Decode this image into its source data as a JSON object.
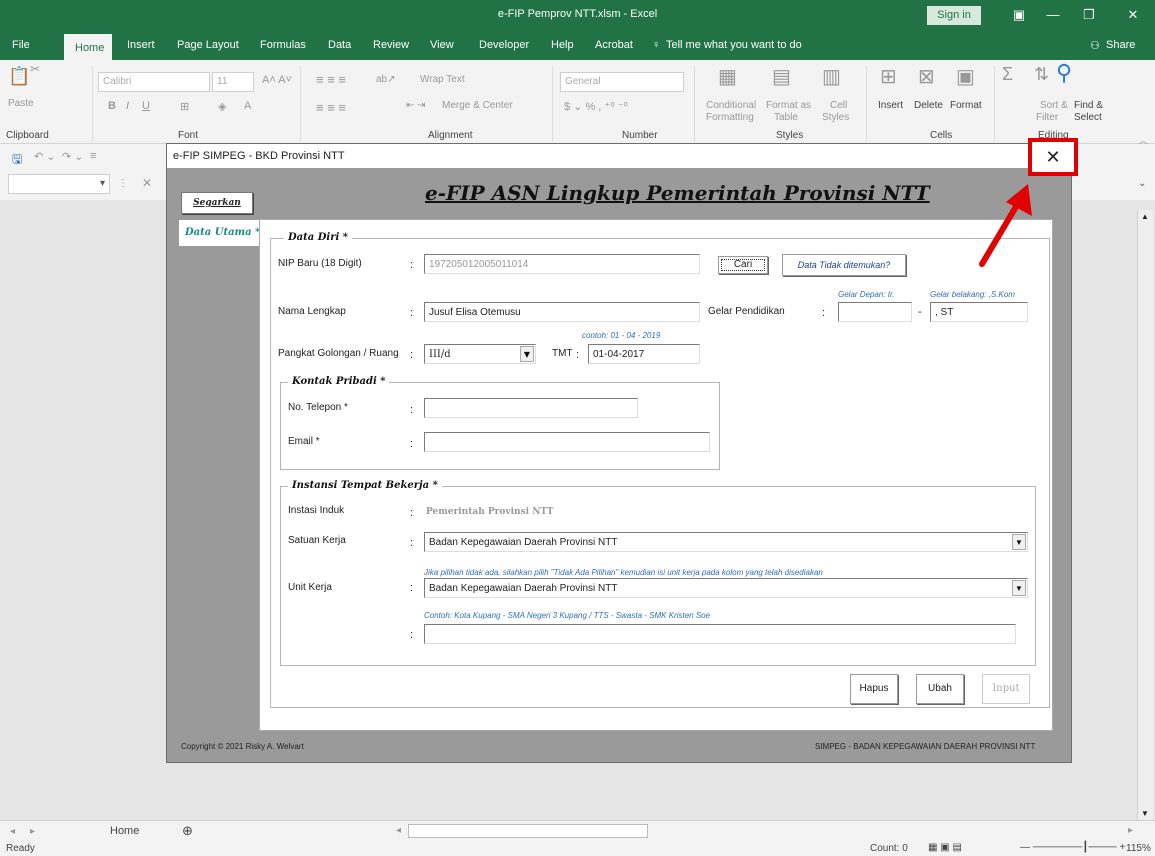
{
  "window": {
    "title": "e-FIP Pemprov NTT.xlsm  -  Excel",
    "signin": "Sign in"
  },
  "tabs": [
    "File",
    "Home",
    "Insert",
    "Page Layout",
    "Formulas",
    "Data",
    "Review",
    "View",
    "Developer",
    "Help",
    "Acrobat"
  ],
  "tellme": "Tell me what you want to do",
  "share": "Share",
  "ribbon": {
    "clipboard": "Clipboard",
    "paste": "Paste",
    "font_group": "Font",
    "font_name": "Calibri",
    "font_size": "11",
    "alignment": "Alignment",
    "wrap_text": "Wrap Text",
    "merge_center": "Merge & Center",
    "number": "Number",
    "number_format": "General",
    "styles": "Styles",
    "conditional": "Conditional",
    "formatting": "Formatting",
    "format_as": "Format as",
    "table": "Table",
    "cell": "Cell",
    "cell_styles": "Styles",
    "cells": "Cells",
    "insert": "Insert",
    "delete": "Delete",
    "format": "Format",
    "editing": "Editing",
    "sort_filter": "Sort &",
    "filter": "Filter",
    "find_select": "Find &",
    "select": "Select"
  },
  "sheet_tab": "Home",
  "status": {
    "ready": "Ready",
    "count": "Count: 0",
    "zoom": "115%"
  },
  "dialog": {
    "title": "e-FIP SIMPEG - BKD Provinsi NTT",
    "heading": "e-FIP ASN Lingkup Pemerintah Provinsi NTT",
    "refresh": "Segarkan",
    "side_tab": "Data Utama *",
    "data_diri": {
      "legend": "Data Diri  *",
      "nip_label": "NIP Baru (18 Digit)",
      "nip_value": "197205012005011014",
      "cari": "Cari",
      "not_found": "Data Tidak ditemukan?",
      "nama_label": "Nama Lengkap",
      "nama_value": "Jusuf Elisa Otemusu",
      "gelar_label": "Gelar Pendidikan",
      "gelar_depan_hint": "Gelar Depan: Ir.",
      "gelar_belakang_hint": "Gelar belakang: ,S.Kom",
      "gelar_depan_value": "",
      "gelar_sep": "-",
      "gelar_belakang_value": ", ST",
      "pangkat_label": "Pangkat Golongan / Ruang",
      "pangkat_value": "III/d",
      "tmt_label": "TMT",
      "tmt_hint": "contoh: 01 - 04 - 2019",
      "tmt_value": "01-04-2017"
    },
    "kontak": {
      "legend": "Kontak Pribadi *",
      "telp_label": "No. Telepon *",
      "telp_value": "",
      "email_label": "Email *",
      "email_value": ""
    },
    "instansi": {
      "legend": "Instansi Tempat Bekerja *",
      "induk_label": "Instasi Induk",
      "induk_value": "Pemerintah Provinsi NTT",
      "satker_label": "Satuan Kerja",
      "satker_value": "Badan Kepegawaian Daerah Provinsi NTT",
      "unit_hint": "Jika pilihan tidak ada, silahkan pilih \"Tidak Ada Pilihan\" kemudian isi unit kerja pada kolom yang telah disediakan",
      "unit_label": "Unit Kerja",
      "unit_value": "Badan Kepegawaian Daerah Provinsi NTT",
      "contoh_hint": "Contoh: Kota Kupang - SMA Negeri 3 Kupang / TTS - Swasta - SMK Kristen Soe",
      "unit_other_value": ""
    },
    "buttons": {
      "hapus": "Hapus",
      "ubah": "Ubah",
      "input": "Input"
    },
    "footer_left": "Copyright © 2021 Risky A. Welvart",
    "footer_right": "SIMPEG - BADAN KEPEGAWAIAN DAERAH PROVINSI NTT",
    "close_glyph": "✕"
  },
  "colors": {
    "excel_green": "#217346",
    "annotation_red": "#e00000",
    "hint_blue": "#2d6fbd"
  }
}
